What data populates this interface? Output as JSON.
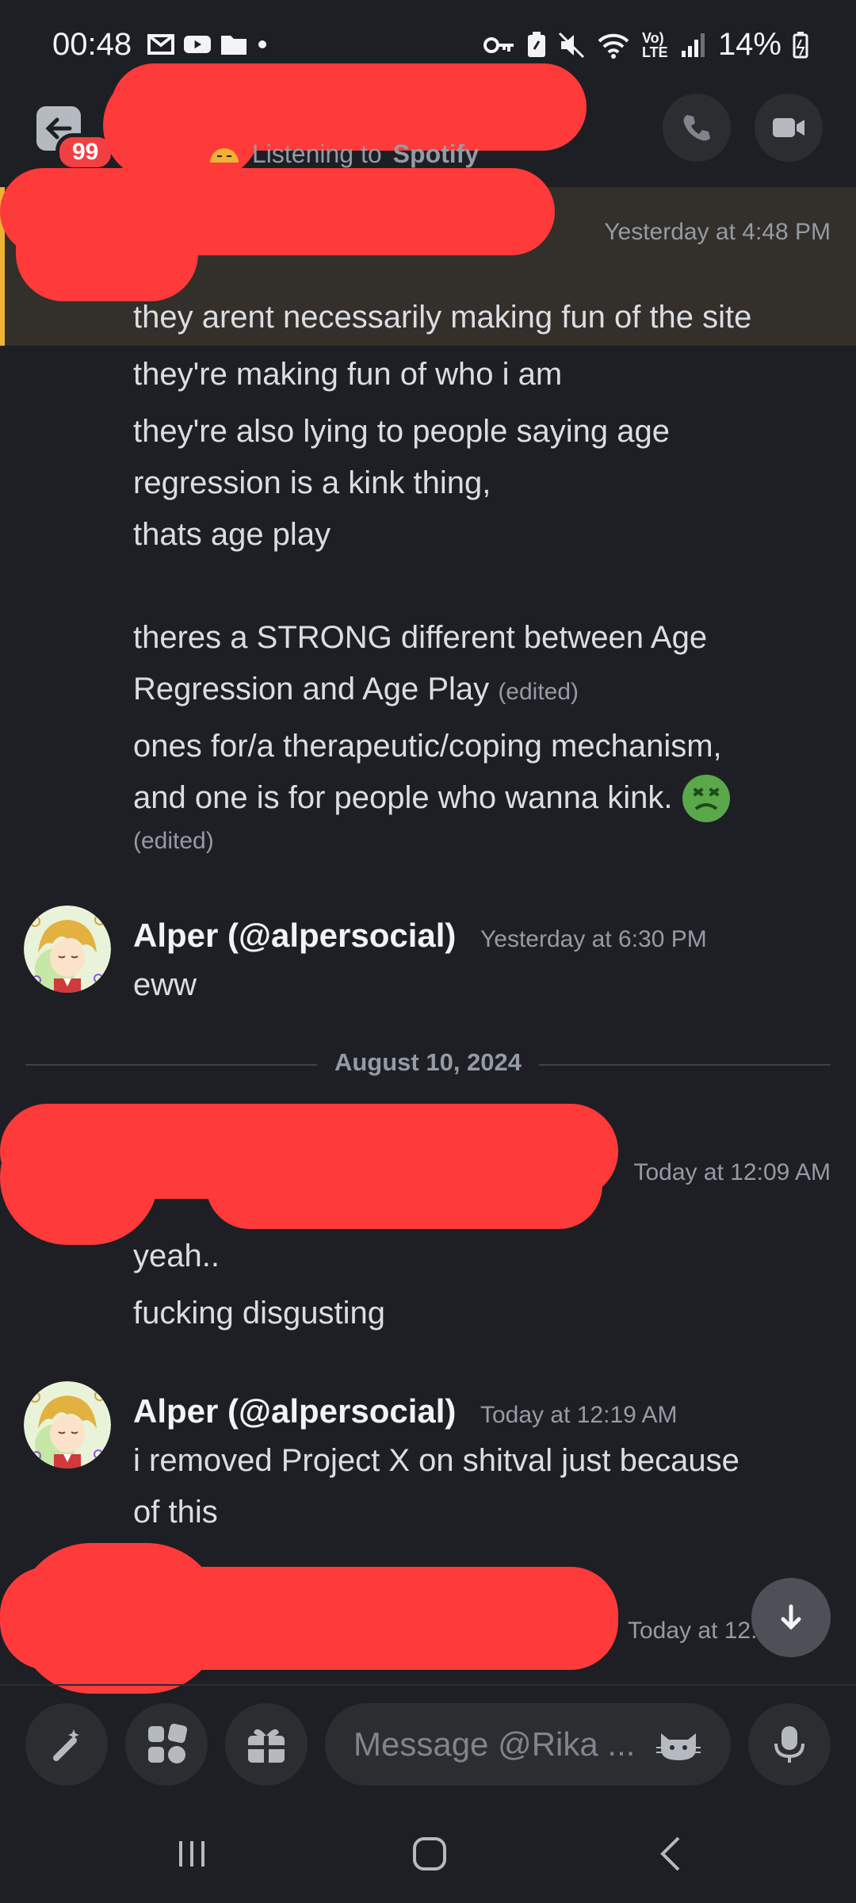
{
  "status_bar": {
    "time": "00:48",
    "battery": "14%",
    "network": "Vo) LTE"
  },
  "header": {
    "unread_count": "99",
    "activity_prefix": "Listening to",
    "activity_app": "Spotify"
  },
  "messages": {
    "block1": {
      "timestamp": "Yesterday at 4:48 PM",
      "lines": {
        "l1": "they arent necessarily making fun of the site",
        "l2": "they're making fun of who i am",
        "l3a": "they're also lying to people saying age",
        "l3b": "regression is a kink thing,",
        "l3c": "thats age play",
        "l4a": "theres a STRONG different between Age",
        "l4b": "Regression and Age Play",
        "l5a": "ones for/a therapeutic/coping mechanism,",
        "l5b": "and one is for people who wanna kink."
      },
      "edited": "(edited)"
    },
    "block2": {
      "author": "Alper (@alpersocial)",
      "timestamp": "Yesterday at 6:30 PM",
      "text": "eww"
    },
    "date_divider": "August 10, 2024",
    "block3": {
      "timestamp": "Today at 12:09 AM",
      "l1": "yeah..",
      "l2": "fucking disgusting"
    },
    "block4": {
      "author": "Alper (@alpersocial)",
      "timestamp": "Today at 12:19 AM",
      "l1": "i removed Project X on shitval just because",
      "l2": "of this"
    },
    "block5": {
      "timestamp": "Today at 12:"
    }
  },
  "composer": {
    "placeholder": "Message @Rika ..."
  },
  "colors": {
    "background": "#1e1f24",
    "mention_highlight": "#332f2a",
    "mention_bar": "#f0b232",
    "badge": "#f23f43",
    "redaction": "#fe3a3a",
    "emoji_green": "#5aa84a"
  },
  "icons": [
    "mail-icon",
    "youtube-icon",
    "folder-icon",
    "key-icon",
    "mute-icon",
    "wifi-icon",
    "signal-icon",
    "battery-icon",
    "phone-icon",
    "video-icon",
    "apps-icon",
    "gift-icon",
    "sparkle-icon",
    "mic-icon",
    "arrow-down-icon"
  ]
}
